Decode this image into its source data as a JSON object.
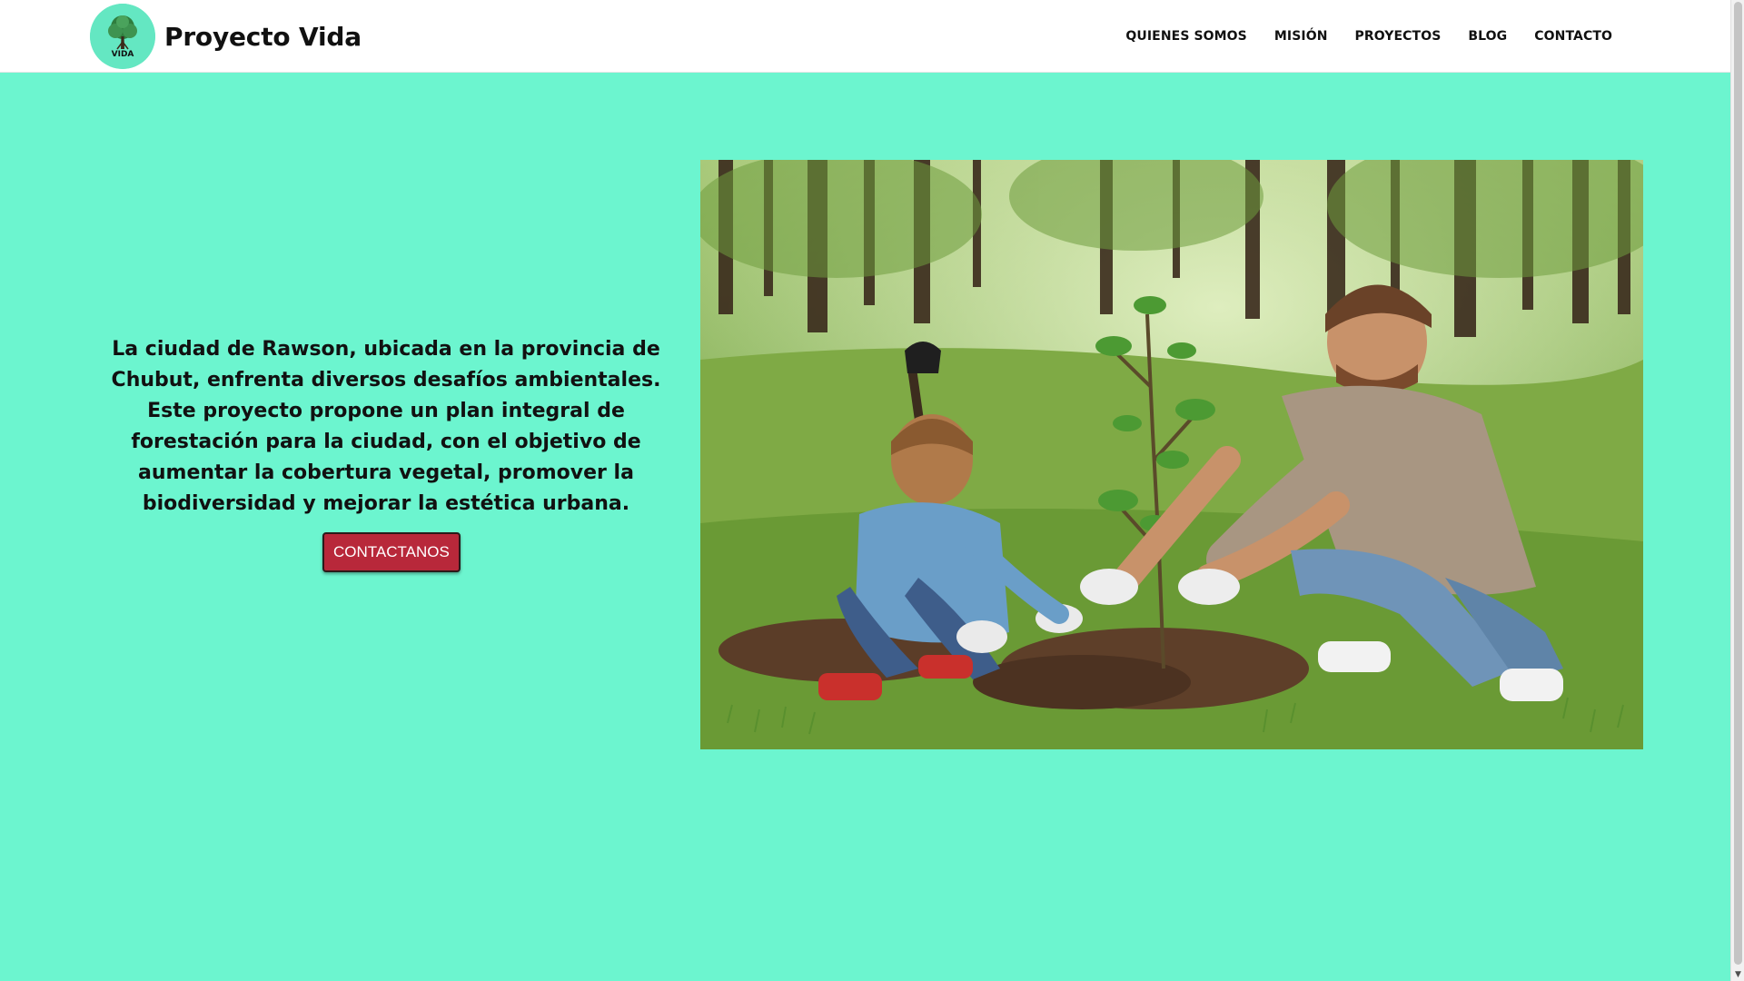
{
  "header": {
    "brand_title": "Proyecto Vida",
    "logo_text": "VIDA",
    "logo_icon": "tree-icon",
    "nav_items": [
      {
        "label": "QUIENES SOMOS"
      },
      {
        "label": "MISIÓN"
      },
      {
        "label": "PROYECTOS"
      },
      {
        "label": "BLOG"
      },
      {
        "label": "CONTACTO"
      }
    ]
  },
  "hero": {
    "paragraph": "La ciudad de Rawson, ubicada en la provincia de Chubut, enfrenta diversos desafíos ambientales. Este proyecto propone un plan integral de forestación para la ciudad, con el objetivo de aumentar la cobertura vegetal, promover la biodiversidad y mejorar la estética urbana.",
    "cta_label": "CONTACTANOS",
    "image_icon": "tree-planting-photo"
  },
  "colors": {
    "page_background": "#6cf5cf",
    "header_background": "#ffffff",
    "cta_background": "#b8283a",
    "logo_background": "#64e7c2"
  }
}
